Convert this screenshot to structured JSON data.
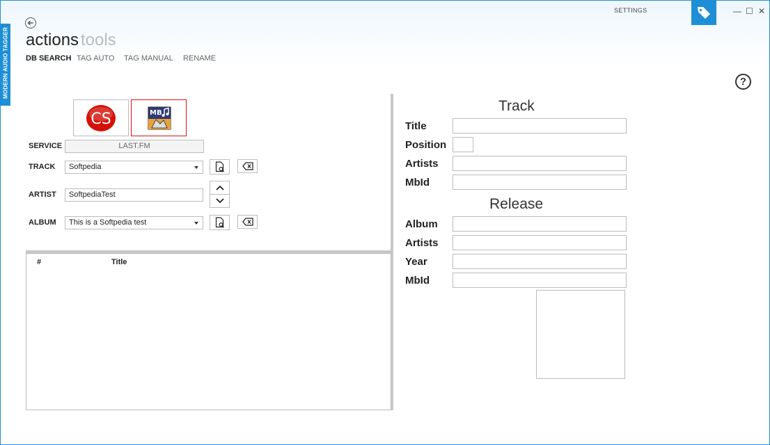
{
  "app": {
    "side_label": "MODERN AUDIO TAGGER",
    "settings_label": "SETTINGS",
    "controls": {
      "minimize": "—",
      "maximize": "☐",
      "close": "✕"
    }
  },
  "header": {
    "title_primary": "actions",
    "title_secondary": "tools",
    "tabs": [
      {
        "label": "DB SEARCH"
      },
      {
        "label": "TAG AUTO"
      },
      {
        "label": "TAG MANUAL"
      },
      {
        "label": "RENAME"
      }
    ]
  },
  "help_label": "?",
  "services": [
    {
      "name": "lastfm",
      "icon": "lastfm-icon",
      "logo_text": "CS"
    },
    {
      "name": "musicbrainz",
      "icon": "musicbrainz-icon",
      "logo_text": "MB"
    }
  ],
  "form": {
    "service": {
      "label": "SERVICE",
      "value": "LAST.FM"
    },
    "track": {
      "label": "TRACK",
      "value": "Softpedia"
    },
    "artist": {
      "label": "ARTIST",
      "value": "SoftpediaTest"
    },
    "album": {
      "label": "ALBUM",
      "value": "This is a Softpedia test"
    }
  },
  "results": {
    "columns": [
      "#",
      "Title"
    ],
    "rows": []
  },
  "track_section": {
    "title": "Track",
    "fields": [
      {
        "label": "Title",
        "value": ""
      },
      {
        "label": "Position",
        "value": ""
      },
      {
        "label": "Artists",
        "value": ""
      },
      {
        "label": "MbId",
        "value": ""
      }
    ]
  },
  "release_section": {
    "title": "Release",
    "fields": [
      {
        "label": "Album",
        "value": ""
      },
      {
        "label": "Artists",
        "value": ""
      },
      {
        "label": "Year",
        "value": ""
      },
      {
        "label": "MbId",
        "value": ""
      }
    ]
  },
  "colors": {
    "accent": "#1e8fd6",
    "selected_border": "#dd1111",
    "lastfm_red": "#d51007"
  }
}
